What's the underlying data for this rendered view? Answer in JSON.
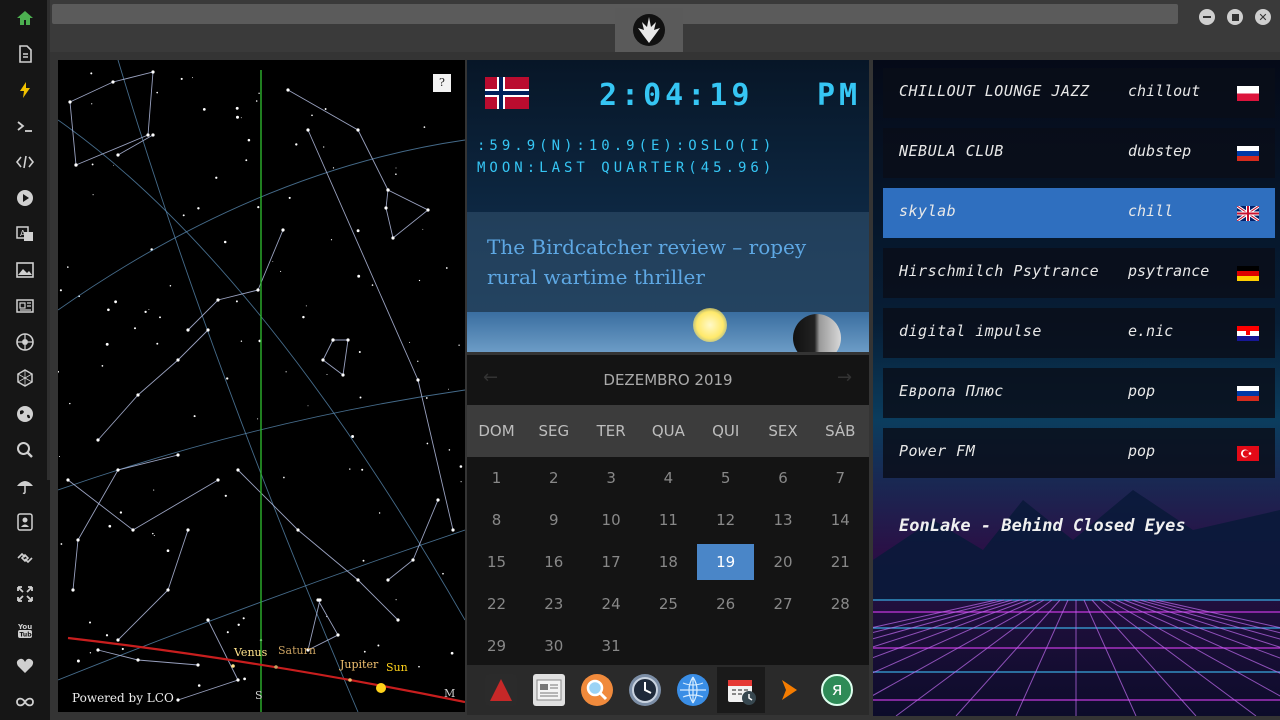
{
  "sidebar": {
    "items": [
      {
        "icon": "home-icon",
        "color": "#4caf50"
      },
      {
        "icon": "document-icon"
      },
      {
        "icon": "lightning-icon",
        "color": "#f2c200"
      },
      {
        "icon": "terminal-icon"
      },
      {
        "icon": "code-icon"
      },
      {
        "icon": "play-icon"
      },
      {
        "icon": "translate-icon"
      },
      {
        "icon": "image-icon"
      },
      {
        "icon": "news-icon"
      },
      {
        "icon": "aperture-icon"
      },
      {
        "icon": "hexagon-icon"
      },
      {
        "icon": "globe-icon"
      },
      {
        "icon": "search-icon"
      },
      {
        "icon": "umbrella-icon"
      },
      {
        "icon": "contacts-icon"
      },
      {
        "icon": "link-icon"
      },
      {
        "icon": "fullscreen-icon"
      },
      {
        "icon": "youtube-icon",
        "label": "You Tube"
      },
      {
        "icon": "heart-icon"
      },
      {
        "icon": "infinity-icon"
      }
    ]
  },
  "window": {
    "logo": "rebel-alliance-icon"
  },
  "sky_map": {
    "help_label": "?",
    "credit": "Powered by LCO",
    "planets": [
      {
        "name": "Venus",
        "color": "#ffe38c"
      },
      {
        "name": "Saturn",
        "color": "#c8a060"
      },
      {
        "name": "Jupiter",
        "color": "#f0c070"
      },
      {
        "name": "Sun",
        "color": "#ffd21a"
      }
    ],
    "compass": [
      {
        "label": "S"
      },
      {
        "label": "M"
      }
    ]
  },
  "clock": {
    "flag": "norway",
    "time": "2:04:19",
    "ampm": "PM",
    "coords": ":59.9(N):10.9(E):OSLO(I)",
    "moon": "MOON:LAST QUARTER(45.96)",
    "headline": "The Birdcatcher review – ropey rural wartime thriller"
  },
  "calendar": {
    "title": "DEZEMBRO 2019",
    "prev": "←",
    "next": "→",
    "weekdays": [
      "DOM",
      "SEG",
      "TER",
      "QUA",
      "QUI",
      "SEX",
      "SÁB"
    ],
    "weeks": [
      [
        "1",
        "2",
        "3",
        "4",
        "5",
        "6",
        "7"
      ],
      [
        "8",
        "9",
        "10",
        "11",
        "12",
        "13",
        "14"
      ],
      [
        "15",
        "16",
        "17",
        "18",
        "19",
        "20",
        "21"
      ],
      [
        "22",
        "23",
        "24",
        "25",
        "26",
        "27",
        "28"
      ],
      [
        "29",
        "30",
        "31",
        "",
        "",
        "",
        ""
      ]
    ],
    "today": "19"
  },
  "dock": {
    "apps": [
      {
        "icon": "launcher-icon",
        "color": "#c62828"
      },
      {
        "icon": "news-app-icon",
        "color": "#e0e0e0"
      },
      {
        "icon": "search-app-icon",
        "color": "#f08a3c"
      },
      {
        "icon": "clock-app-icon",
        "color": "#7c8ea6"
      },
      {
        "icon": "browser-app-icon",
        "color": "#3a8ee6"
      },
      {
        "icon": "calendar-app-icon",
        "color": "#e53935"
      },
      {
        "icon": "play-app-icon",
        "color": "#f57c00"
      },
      {
        "icon": "yandex-app-icon",
        "color": "#2e8b57",
        "label": "я"
      }
    ]
  },
  "radio": {
    "stations": [
      {
        "name": "CHILLOUT LOUNGE JAZZ",
        "genre": "chillout",
        "flag": "poland"
      },
      {
        "name": "NEBULA CLUB",
        "genre": "dubstep",
        "flag": "russia"
      },
      {
        "name": "skylab",
        "genre": "chill",
        "flag": "uk",
        "selected": true
      },
      {
        "name": "Hirschmilch Psytrance",
        "genre": "psytrance",
        "flag": "germany"
      },
      {
        "name": "digital impulse",
        "genre": "e.nic",
        "flag": "croatia"
      },
      {
        "name": "Европа Плюс",
        "genre": "pop",
        "flag": "russia"
      },
      {
        "name": "Power FM",
        "genre": "pop",
        "flag": "turkey"
      }
    ],
    "now_playing": "EonLake - Behind Closed Eyes"
  }
}
